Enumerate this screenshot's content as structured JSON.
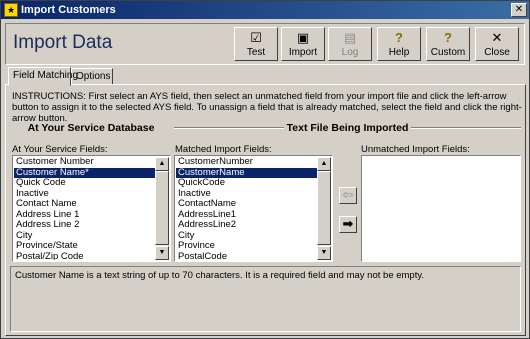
{
  "window": {
    "title": "Import Customers",
    "close_glyph": "✕"
  },
  "header": {
    "title": "Import Data"
  },
  "toolbar": [
    {
      "label": "Test",
      "icon": "clipboard-check-icon",
      "glyph": "☑",
      "enabled": true
    },
    {
      "label": "Import",
      "icon": "floppy-disk-icon",
      "glyph": "▣",
      "enabled": true
    },
    {
      "label": "Log",
      "icon": "document-icon",
      "glyph": "▤",
      "enabled": false
    },
    {
      "label": "Help",
      "icon": "question-icon",
      "glyph": "?",
      "enabled": true
    },
    {
      "label": "Custom",
      "icon": "question-icon",
      "glyph": "?",
      "enabled": true
    },
    {
      "label": "Close",
      "icon": "close-icon",
      "glyph": "✕",
      "enabled": true
    }
  ],
  "tabs": [
    {
      "label": "Field Matching",
      "active": true
    },
    {
      "label": "Options",
      "active": false
    }
  ],
  "instructions": "INSTRUCTIONS: First select an AYS field, then select an unmatched field from your import file and click the left-arrow button to assign it to the selected AYS field. To unassign a field that is already matched, select the field and click the right-arrow button.",
  "sections": {
    "left_title": "At Your Service Database",
    "right_title": "Text File Being Imported"
  },
  "ays_fields": {
    "label": "At Your Service Fields:",
    "items": [
      "Customer Number",
      "Customer Name*",
      "Quick Code",
      "Inactive",
      "Contact Name",
      "Address Line 1",
      "Address Line 2",
      "City",
      "Province/State",
      "Postal/Zip Code"
    ],
    "selected_index": 1
  },
  "matched_fields": {
    "label": "Matched Import Fields:",
    "items": [
      "CustomerNumber",
      "CustomerName",
      "QuickCode",
      "Inactive",
      "ContactName",
      "AddressLine1",
      "AddressLine2",
      "City",
      "Province",
      "PostalCode"
    ],
    "selected_index": 1
  },
  "unmatched_fields": {
    "label": "Unmatched Import Fields:",
    "items": []
  },
  "arrows": {
    "left_glyph": "⇦",
    "right_glyph": "➡"
  },
  "description": "Customer Name is a text string of up to 70 characters.  It is a required field and may not be empty."
}
